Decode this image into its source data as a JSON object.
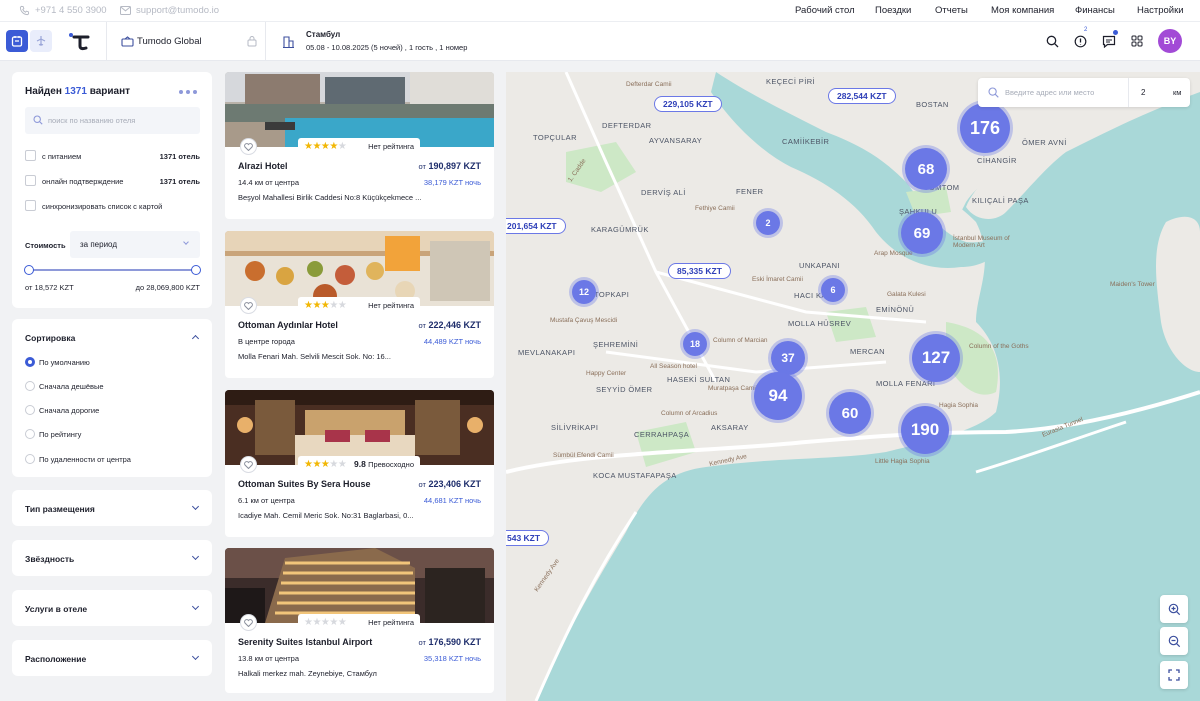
{
  "topbar": {
    "phone": "+971 4 550 3900",
    "email": "support@tumodo.io",
    "nav": [
      "Рабочий стол",
      "Поездки",
      "Отчеты",
      "Моя компания",
      "Финансы",
      "Настройки"
    ]
  },
  "header": {
    "company": "Tumodo Global",
    "city": "Стамбул",
    "trip_details": "05.08 - 10.08.2025 (5 ночей) , 1 гость , 1 номер",
    "avatar": "BY",
    "notif_count": "2"
  },
  "filters": {
    "found_prefix": "Найден",
    "found_count": "1371",
    "found_suffix": "вариант",
    "search_placeholder": "поиск по названию отеля",
    "checkboxes": [
      {
        "label": "с питанием",
        "count": "1371 отель"
      },
      {
        "label": "онлайн подтверждение",
        "count": "1371 отель"
      },
      {
        "label": "синхронизировать список с картой",
        "count": ""
      }
    ],
    "cost_label": "Стоимость",
    "cost_period": "за период",
    "price_min": "от 18,572 KZT",
    "price_max": "до 28,069,800 KZT",
    "range_fraction": [
      0,
      1
    ]
  },
  "sorting": {
    "title": "Сортировка",
    "options": [
      "По умолчанию",
      "Сначала дешёвые",
      "Сначала дорогие",
      "По рейтингу",
      "По удаленности от центра"
    ],
    "selected": 0
  },
  "accordions": [
    "Тип размещения",
    "Звёздность",
    "Услуги в отеле",
    "Расположение"
  ],
  "hotels": [
    {
      "name": "Alrazi Hotel",
      "stars": 4,
      "rating": "Нет рейтинга",
      "score": "",
      "price": "190,897 KZT",
      "price_prefix": "от",
      "per_night": "38,179 KZT ночь",
      "distance": "14.4 км от центра",
      "address": "Beşyol Mahallesi Birlik Caddesi No:8 Küçükçekmece ..."
    },
    {
      "name": "Ottoman Aydınlar Hotel",
      "stars": 3,
      "rating": "Нет рейтинга",
      "score": "",
      "price": "222,446 KZT",
      "price_prefix": "от",
      "per_night": "44,489 KZT ночь",
      "distance": "В центре города",
      "address": "Molla Fenari Mah. Selvili Mescit Sok. No: 16..."
    },
    {
      "name": "Ottoman Suites By Sera House",
      "stars": 3,
      "rating": "Превосходно",
      "score": "9.8",
      "price": "223,406 KZT",
      "price_prefix": "от",
      "per_night": "44,681 KZT ночь",
      "distance": "6.1 км от центра",
      "address": "Icadiye Mah. Cemil Meric Sok. No:31 Baglarbasi, 0..."
    },
    {
      "name": "Serenity Suites Istanbul Airport",
      "stars": 0,
      "rating": "Нет рейтинга",
      "score": "",
      "price": "176,590 KZT",
      "price_prefix": "от",
      "per_night": "35,318 KZT ночь",
      "distance": "13.8 км от центра",
      "address": "Halkali merkez mah. Zeynebiye, Стамбул"
    }
  ],
  "map": {
    "search_placeholder": "Введите адрес или место",
    "radius_value": "2",
    "radius_unit": "км",
    "clusters": [
      "176",
      "68",
      "69",
      "2",
      "6",
      "12",
      "18",
      "37",
      "94",
      "60",
      "127",
      "190"
    ],
    "price_tags": [
      "229,105 KZT",
      "282,544 KZT",
      "201,654 KZT",
      "85,335 KZT",
      "543 KZT"
    ],
    "districts": [
      "KEÇECİ PİRİ",
      "DEFTERDAR",
      "TOPÇULAR",
      "AYVANSARAY",
      "CAMİİKEBİR",
      "BOSTAN",
      "ÖMER AVNİ",
      "CİHANGİR",
      "DERVİŞ ALİ",
      "FENER",
      "TOMTOM",
      "ŞAHKULU",
      "KILIÇALİ PAŞA",
      "KARAGÜMRÜK",
      "UNKAPANI",
      "HACI KADIN",
      "TOPKAPI",
      "ŞEHREMİNİ",
      "MOLLA HÜSREV",
      "EMİNÖNÜ",
      "MERCAN",
      "MEVLANAKAPI",
      "HASEKİ SULTAN",
      "SEYYİD ÖMER",
      "MOLLA FENARİ",
      "AKSARAY",
      "SİLİVRİKAPI",
      "CERRAHPAŞA",
      "KOCA MUSTAFAPAŞA"
    ],
    "places": [
      "Defterdar Camii",
      "Fethiye Camii",
      "Eski İmaret Camii",
      "Mustafa Çavuş Mescidi",
      "Column of Marcian",
      "Happy Center",
      "All Season hotel",
      "Muratpaşa Camii",
      "Column of Arcadius",
      "Sümbül Efendi Camii",
      "Arap Mosque",
      "Galata Kulesi",
      "İstanbul Museum of Modern Art",
      "Maiden's Tower",
      "Column of the Goths",
      "Hagia Sophia",
      "Little Hagia Sophia",
      "Kennedy Ave",
      "Eurasia Tunnel",
      "1. Cadde",
      "Kennedy Ave"
    ]
  }
}
